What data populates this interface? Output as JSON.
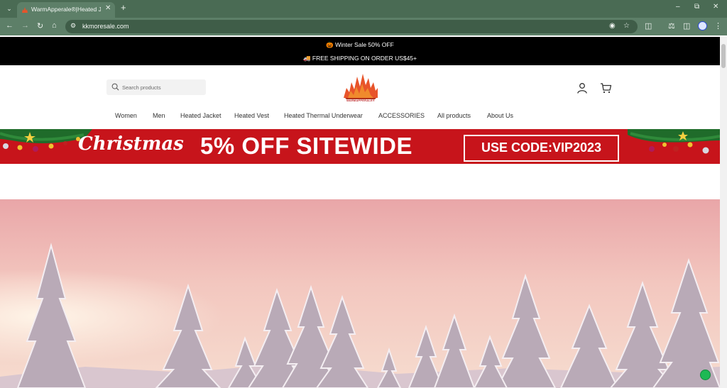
{
  "browser": {
    "tab_title": "WarmApperale®|Heated Jacket",
    "url": "kkmoresale.com",
    "accent": "#4a6b54"
  },
  "announcement": {
    "line1": "🎃 Winter Sale 50% OFF",
    "line2": "🚚 FREE SHIPPING ON ORDER US$45+"
  },
  "header": {
    "search_placeholder": "Search products",
    "logo_text": "WARMAPPERALE®"
  },
  "nav": {
    "items": [
      "Women",
      "Men",
      "Heated Jacket",
      "Heated Vest",
      "Heated Thermal Underwear",
      "ACCESSORIES",
      "All products",
      "About Us"
    ]
  },
  "promo": {
    "christmas": "Christmas",
    "headline": "5% OFF SITEWIDE",
    "code": "USE CODE:VIP2023",
    "color": "#c7141b"
  }
}
